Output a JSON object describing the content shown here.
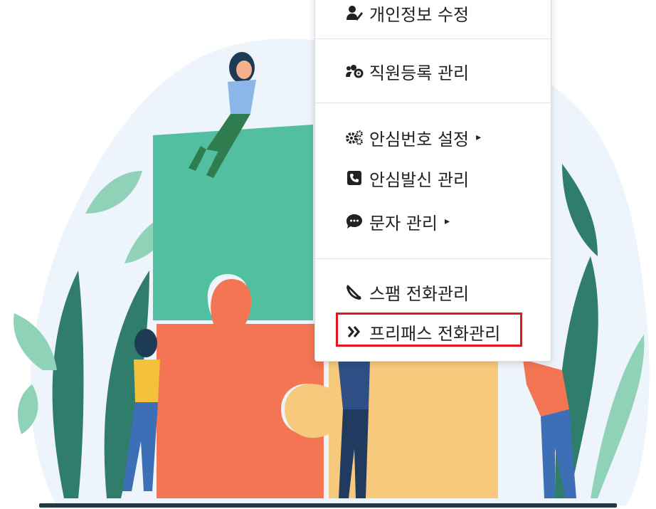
{
  "menu": {
    "items": [
      {
        "label": "개인정보 수정",
        "icon": "user-edit-icon"
      },
      {
        "label": "직원등록 관리",
        "icon": "users-cog-icon"
      },
      {
        "label": "안심번호 설정",
        "icon": "cogs-icon",
        "has_submenu": true
      },
      {
        "label": "안심발신 관리",
        "icon": "phone-square-icon"
      },
      {
        "label": "문자 관리",
        "icon": "sms-icon",
        "has_submenu": true
      },
      {
        "label": "스팸 전화관리",
        "icon": "phone-slash-icon"
      },
      {
        "label": "프리패스 전화관리",
        "icon": "angle-double-right-icon"
      }
    ],
    "highlighted_item": "프리패스 전화관리",
    "submenu_caret": "▸"
  },
  "colors": {
    "highlight_border": "#e8141c",
    "puzzle_green": "#52bfa1",
    "puzzle_orange": "#f37553",
    "puzzle_yellow": "#f6c97c",
    "leaf_dark": "#2f7d6a",
    "leaf_light": "#8fd2b8",
    "background_blob": "#eef4fb"
  }
}
